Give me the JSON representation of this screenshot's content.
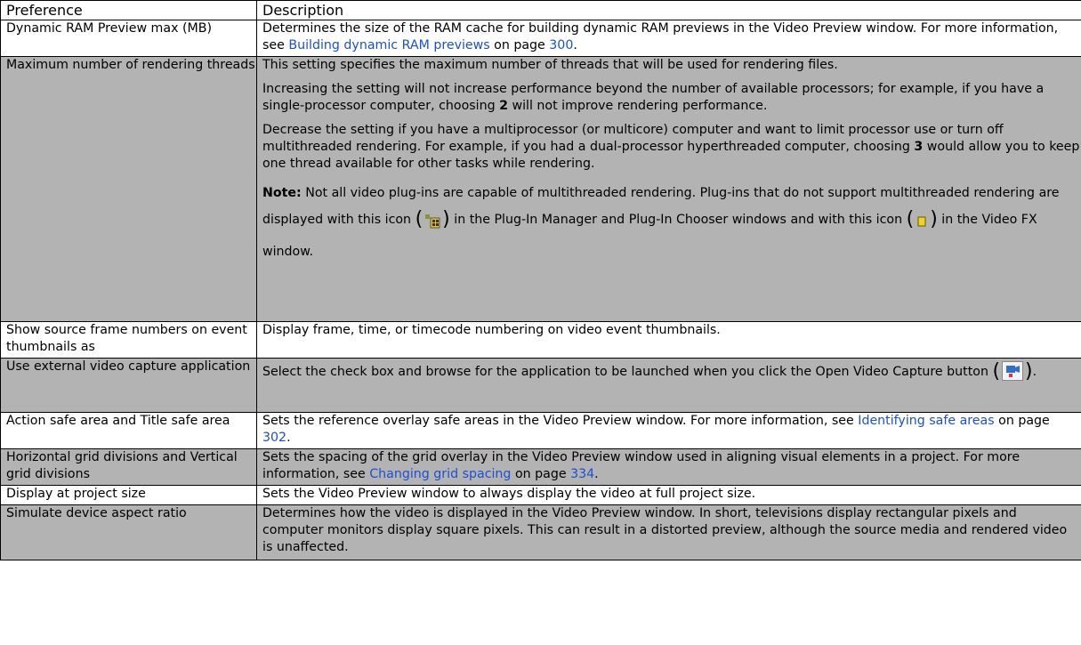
{
  "headers": {
    "preference": "Preference",
    "description": "Description"
  },
  "rows": {
    "ram": {
      "pref": "Dynamic RAM Preview max (MB)",
      "desc_pre": "Determines the size of the RAM cache for building dynamic RAM previews in the Video Preview window. For more information, see ",
      "link": "Building dynamic RAM previews",
      "mid": " on page ",
      "page": "300",
      "end": "."
    },
    "threads": {
      "pref": "Maximum number of rendering threads",
      "p1": "This setting specifies the maximum number of threads that will be used for rendering files.",
      "p2_pre": "Increasing the setting will not increase performance beyond the number of available processors; for example, if you have a single-processor computer, choosing ",
      "p2_bold": "2",
      "p2_post": " will not improve rendering performance.",
      "p3_pre": "Decrease the setting if you have a multiprocessor (or multicore) computer and want to limit processor use or turn off multithreaded rendering. For example, if you had a dual-processor hyperthreaded computer, choosing ",
      "p3_bold": "3",
      "p3_post": " would allow you to keep one thread available for other tasks while rendering.",
      "note_label": "Note:",
      "note_1": " Not all video plug-ins are capable of multithreaded rendering. Plug-ins that do not support multithreaded rendering are displayed with this icon ",
      "paren_open": "(",
      "paren_close": ")",
      "note_2": " in the Plug-In Manager and Plug-In Chooser windows and with this icon ",
      "note_3": " in the Video FX window.",
      "icon1": "plugin-manager-icon",
      "icon2": "video-fx-plugin-icon"
    },
    "thumb": {
      "pref": "Show source frame numbers on event thumbnails as",
      "desc": "Display frame, time, or timecode numbering on video event thumbnails."
    },
    "capture": {
      "pref": "Use external video capture application",
      "desc_pre": "Select the check box and browse for the application to be launched when you click the Open Video Capture button ",
      "paren_open": "(",
      "paren_close": ")",
      "end": ".",
      "icon": "open-video-capture-icon"
    },
    "safe": {
      "pref": "Action safe area and Title safe area",
      "desc_pre": "Sets the reference overlay safe areas in the Video Preview window. For more information, see ",
      "link": "Identifying safe areas",
      "mid": " on page ",
      "page": "302",
      "end": "."
    },
    "grid": {
      "pref": "Horizontal grid divisions and Vertical grid divisions",
      "desc_pre": "Sets the spacing of the grid overlay in the Video Preview window used in aligning visual elements in a project. For more information, see ",
      "link": "Changing grid spacing",
      "mid": " on page ",
      "page": "334",
      "end": "."
    },
    "display": {
      "pref": "Display at project size",
      "desc": "Sets the Video Preview window to always display the video at full project size."
    },
    "aspect": {
      "pref": "Simulate device aspect ratio",
      "desc": "Determines how the video is displayed in the Video Preview window. In short, televisions display rectangular pixels and computer monitors display square pixels. This can result in a distorted preview, although the source media and rendered video is unaffected."
    }
  },
  "colors": {
    "shade": "#b3b3b3",
    "link": "#1a4fd6"
  }
}
